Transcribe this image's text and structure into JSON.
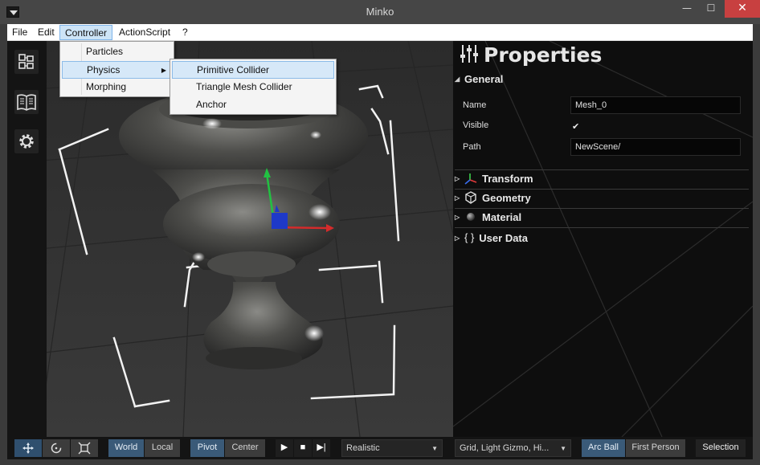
{
  "window": {
    "title": "Minko",
    "minimize": "—",
    "maximize": "☐",
    "close": "✕"
  },
  "menubar": {
    "items": [
      "File",
      "Edit",
      "Controller",
      "ActionScript",
      "?"
    ],
    "active": "Controller"
  },
  "controller_menu": {
    "items": [
      "Particles",
      "Physics",
      "Morphing"
    ],
    "highlighted": "Physics"
  },
  "physics_submenu": {
    "items": [
      "Primitive Collider",
      "Triangle Mesh Collider",
      "Anchor"
    ],
    "highlighted": "Primitive Collider"
  },
  "left_toolbar": {
    "icons": [
      "scene-graph-icon",
      "library-book-icon",
      "settings-gear-icon"
    ]
  },
  "properties": {
    "title": "Properties",
    "general": {
      "label": "General",
      "name_label": "Name",
      "name_value": "Mesh_0",
      "visible_label": "Visible",
      "visible_checked": true,
      "path_label": "Path",
      "path_value": "NewScene/"
    },
    "sections": [
      "Transform",
      "Geometry",
      "Material",
      "User Data"
    ],
    "user_data_icon": "{ }"
  },
  "bottom_toolbar": {
    "space": [
      "World",
      "Local"
    ],
    "space_active": "World",
    "pivot": [
      "Pivot",
      "Center"
    ],
    "pivot_active": "Pivot",
    "render_mode": "Realistic",
    "overlays": "Grid, Light Gizmo, Hi...",
    "camera": [
      "Arc Ball",
      "First Person"
    ],
    "camera_active": "Arc Ball",
    "selection": "Selection"
  },
  "colors": {
    "accent": "#3a5a78",
    "menu_highlight": "#d6e8f8",
    "close_button": "#c84040"
  }
}
